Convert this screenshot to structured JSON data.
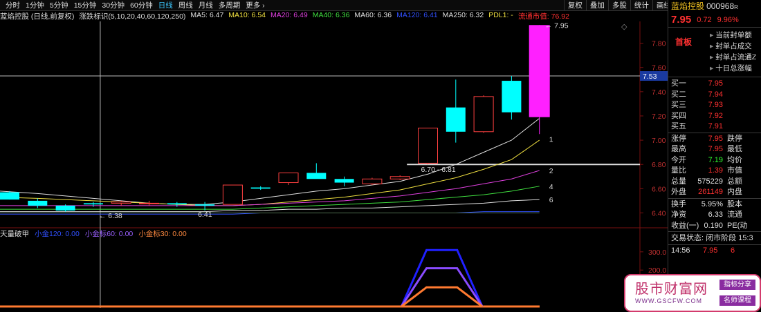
{
  "toolbar": {
    "timeframes": [
      "分时",
      "1分钟",
      "5分钟",
      "15分钟",
      "30分钟",
      "60分钟",
      "日线",
      "周线",
      "月线",
      "多周期",
      "更多 ›"
    ],
    "active": "日线",
    "right_buttons": [
      "复权",
      "叠加",
      "多股",
      "统计",
      "画线",
      "F10",
      "简概",
      "标记",
      "返回"
    ]
  },
  "chart_header": {
    "stock_label": "蓝焰控股 (日线,前复权)",
    "indicator_label": "涨跌标识(5,10,20,40,60,120,250)",
    "ma": [
      {
        "label": "MA5: 6.47",
        "color": "#e0e0e0"
      },
      {
        "label": "MA10: 6.54",
        "color": "#f0e040"
      },
      {
        "label": "MA20: 6.49",
        "color": "#e040e0"
      },
      {
        "label": "MA40: 6.36",
        "color": "#40e040"
      },
      {
        "label": "MA60: 6.36",
        "color": "#e0e0e0"
      },
      {
        "label": "MA120: 6.41",
        "color": "#3050ff"
      },
      {
        "label": "MA250: 6.32",
        "color": "#e0e0e0"
      },
      {
        "label": "PDL1: -",
        "color": "#f0e040"
      },
      {
        "label": "流通市值: 76.92",
        "color": "#ff3030"
      }
    ]
  },
  "chart_data": {
    "type": "candlestick",
    "ylim": [
      6.3,
      7.98
    ],
    "y_ticks": [
      "7.80",
      "7.60",
      "7.40",
      "7.20",
      "7.00",
      "6.80",
      "6.60",
      "6.40"
    ],
    "crosshair_price": "7.53",
    "candles": [
      {
        "o": 6.57,
        "h": 6.58,
        "l": 6.51,
        "c": 6.51
      },
      {
        "o": 6.5,
        "h": 6.52,
        "l": 6.44,
        "c": 6.46
      },
      {
        "o": 6.46,
        "h": 6.47,
        "l": 6.41,
        "c": 6.42
      },
      {
        "o": 6.48,
        "h": 6.49,
        "l": 6.45,
        "c": 6.47
      },
      {
        "o": 6.48,
        "h": 6.5,
        "l": 6.46,
        "c": 6.49
      },
      {
        "o": 6.48,
        "h": 6.5,
        "l": 6.46,
        "c": 6.48
      },
      {
        "o": 6.48,
        "h": 6.49,
        "l": 6.45,
        "c": 6.47
      },
      {
        "o": 6.47,
        "h": 6.49,
        "l": 6.42,
        "c": 6.46
      },
      {
        "o": 6.47,
        "h": 6.63,
        "l": 6.47,
        "c": 6.63
      },
      {
        "o": 6.61,
        "h": 6.62,
        "l": 6.59,
        "c": 6.6
      },
      {
        "o": 6.65,
        "h": 6.73,
        "l": 6.63,
        "c": 6.73
      },
      {
        "o": 6.73,
        "h": 6.81,
        "l": 6.69,
        "c": 6.68
      },
      {
        "o": 6.68,
        "h": 6.7,
        "l": 6.62,
        "c": 6.65
      },
      {
        "o": 6.64,
        "h": 6.69,
        "l": 6.63,
        "c": 6.68
      },
      {
        "o": 6.68,
        "h": 6.71,
        "l": 6.67,
        "c": 6.7
      },
      {
        "o": 6.81,
        "h": 7.1,
        "l": 6.8,
        "c": 7.1
      },
      {
        "o": 7.27,
        "h": 7.5,
        "l": 6.98,
        "c": 7.07
      },
      {
        "o": 7.07,
        "h": 7.37,
        "l": 7.06,
        "c": 7.36
      },
      {
        "o": 7.49,
        "h": 7.53,
        "l": 7.17,
        "c": 7.23
      },
      {
        "o": 7.19,
        "h": 7.95,
        "l": 7.05,
        "c": 7.95
      }
    ],
    "limit_up_index": 19,
    "ma_lines": [
      {
        "name": "MA5",
        "color": "#e0e0e0",
        "values": [
          6.58,
          6.56,
          6.54,
          6.52,
          6.5,
          6.48,
          6.47,
          6.47,
          6.49,
          6.52,
          6.55,
          6.58,
          6.6,
          6.63,
          6.66,
          6.72,
          6.8,
          6.9,
          7.0,
          7.18
        ]
      },
      {
        "name": "MA10",
        "color": "#f0e040",
        "values": [
          6.53,
          6.52,
          6.51,
          6.5,
          6.49,
          6.48,
          6.47,
          6.46,
          6.46,
          6.47,
          6.49,
          6.51,
          6.53,
          6.56,
          6.59,
          6.64,
          6.69,
          6.76,
          6.84,
          7.0
        ]
      },
      {
        "name": "MA20",
        "color": "#e040e0",
        "values": [
          6.46,
          6.46,
          6.46,
          6.46,
          6.46,
          6.46,
          6.46,
          6.46,
          6.46,
          6.47,
          6.48,
          6.49,
          6.5,
          6.52,
          6.54,
          6.57,
          6.6,
          6.64,
          6.68,
          6.75
        ]
      },
      {
        "name": "MA40",
        "color": "#40e040",
        "values": [
          6.43,
          6.43,
          6.43,
          6.43,
          6.43,
          6.43,
          6.43,
          6.43,
          6.43,
          6.44,
          6.45,
          6.46,
          6.47,
          6.48,
          6.49,
          6.51,
          6.53,
          6.55,
          6.58,
          6.62
        ]
      },
      {
        "name": "MA60",
        "color": "#e0e0e0",
        "values": [
          6.41,
          6.41,
          6.41,
          6.41,
          6.41,
          6.41,
          6.41,
          6.41,
          6.42,
          6.42,
          6.43,
          6.43,
          6.44,
          6.44,
          6.45,
          6.46,
          6.47,
          6.48,
          6.5,
          6.51
        ]
      },
      {
        "name": "MA120",
        "color": "#3050ff",
        "values": [
          6.39,
          6.39,
          6.39,
          6.39,
          6.39,
          6.39,
          6.39,
          6.39,
          6.39,
          6.4,
          6.4,
          6.4,
          6.4,
          6.4,
          6.4,
          6.4,
          6.4,
          6.41,
          6.41,
          6.41
        ]
      },
      {
        "name": "MA250",
        "color": "#507050",
        "values": [
          6.4,
          6.4,
          6.4,
          6.4,
          6.4,
          6.4,
          6.4,
          6.4,
          6.4,
          6.4,
          6.4,
          6.4,
          6.4,
          6.4,
          6.4,
          6.4,
          6.4,
          6.4,
          6.4,
          6.4
        ]
      }
    ],
    "annotations": [
      {
        "text": "← 6.38",
        "candle": 3,
        "price": 6.38
      },
      {
        "text": "6.41",
        "candle": 7,
        "price": 6.39
      },
      {
        "text": "6.70 - 6.81",
        "candle": 15,
        "price": 6.76
      },
      {
        "text": "← 7.95",
        "candle": 19,
        "price": 7.95
      },
      {
        "text": "1",
        "candle": 19,
        "price": 7.01
      },
      {
        "text": "2",
        "candle": 19,
        "price": 6.75
      },
      {
        "text": "4",
        "candle": 19,
        "price": 6.62
      },
      {
        "text": "6",
        "candle": 19,
        "price": 6.51
      }
    ],
    "support_price": 6.8,
    "crosshair_x_candle": 3,
    "sub_chart": {
      "y_ticks": [
        "300.0",
        "200.0"
      ],
      "ylim": [
        0,
        360
      ],
      "series": [
        {
          "name": "小金标120",
          "color": "#2020ff",
          "values": [
            0,
            0,
            0,
            0,
            0,
            0,
            0,
            0,
            0,
            0,
            0,
            0,
            0,
            0,
            0,
            310,
            310,
            0,
            0,
            0
          ]
        },
        {
          "name": "小金标60",
          "color": "#8a4cff",
          "values": [
            0,
            0,
            0,
            0,
            0,
            0,
            0,
            0,
            0,
            0,
            0,
            0,
            0,
            0,
            0,
            210,
            210,
            0,
            0,
            0
          ]
        },
        {
          "name": "小金标30",
          "color": "#ff7a30",
          "values": [
            0,
            0,
            0,
            0,
            0,
            0,
            0,
            0,
            0,
            0,
            0,
            0,
            0,
            0,
            0,
            105,
            105,
            0,
            0,
            0
          ]
        }
      ]
    }
  },
  "sub_header": {
    "title": "天量破甲",
    "items": [
      {
        "label": "小金120: 0.00",
        "color": "#3050ff"
      },
      {
        "label": "小金标60: 0.00",
        "color": "#9a60ff"
      },
      {
        "label": "小金标30: 0.00",
        "color": "#ff8a40"
      }
    ]
  },
  "quote": {
    "name": "蓝焰控股",
    "code": "000968",
    "code_suffix": "R",
    "price": "7.95",
    "change": "0.72",
    "pct": "9.96%",
    "tag": "首板",
    "side_items": [
      "当前封单额",
      "封单占成交",
      "封单占流通Z",
      "十日总涨幅"
    ],
    "bids": [
      {
        "label": "买一",
        "value": "7.95"
      },
      {
        "label": "买二",
        "value": "7.94"
      },
      {
        "label": "买三",
        "value": "7.93"
      },
      {
        "label": "买四",
        "value": "7.92"
      },
      {
        "label": "买五",
        "value": "7.91"
      }
    ],
    "stats": [
      {
        "l1": "涨停",
        "v1": "7.95",
        "l2": "跌停",
        "c": "#ff3030"
      },
      {
        "l1": "最高",
        "v1": "7.95",
        "l2": "最低",
        "c": "#ff3030"
      },
      {
        "l1": "今开",
        "v1": "7.19",
        "l2": "均价",
        "c": "#30ff30"
      },
      {
        "l1": "量比",
        "v1": "1.39",
        "l2": "市值",
        "c": "#ff3030"
      },
      {
        "l1": "总量",
        "v1": "575229",
        "l2": "总额",
        "c": "#e0e0e0"
      },
      {
        "l1": "外盘",
        "v1": "261149",
        "l2": "内盘",
        "c": "#ff3030"
      }
    ],
    "stats2": [
      {
        "l1": "换手",
        "v1": "5.95%",
        "l2": "股本"
      },
      {
        "l1": "净资",
        "v1": "6.33",
        "l2": "流通"
      },
      {
        "l1": "收益(一)",
        "v1": "0.190",
        "l2": "PE(动"
      }
    ],
    "trade_state": "交易状态: 闭市阶段 15:3",
    "last_tick": {
      "time": "14:56",
      "price": "7.95",
      "vol": "6"
    }
  },
  "logo": {
    "title": "股市财富网",
    "url": "WWW.GSCFW.COM",
    "tag1": "指标分享",
    "tag2": "名师课程"
  }
}
